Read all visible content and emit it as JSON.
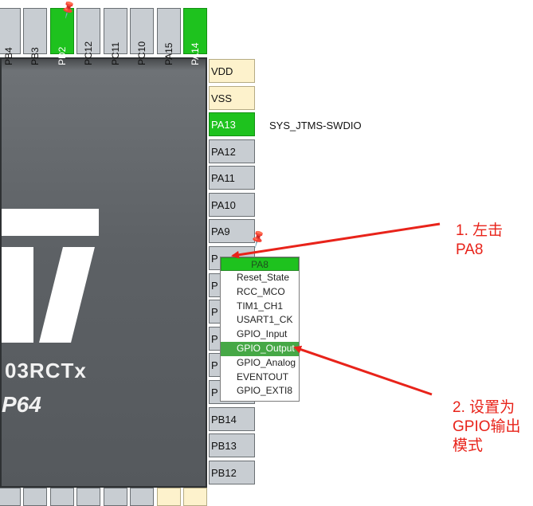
{
  "top_pins": [
    {
      "label": "PB4",
      "state": "default"
    },
    {
      "label": "PB3",
      "state": "default"
    },
    {
      "label": "PD2",
      "state": "assigned"
    },
    {
      "label": "PC12",
      "state": "default"
    },
    {
      "label": "PC11",
      "state": "default"
    },
    {
      "label": "PC10",
      "state": "default"
    },
    {
      "label": "PA15",
      "state": "default"
    },
    {
      "label": "PA14",
      "state": "assigned"
    }
  ],
  "right_pins": [
    {
      "label": "VDD",
      "state": "power"
    },
    {
      "label": "VSS",
      "state": "power"
    },
    {
      "label": "PA13",
      "state": "assigned"
    },
    {
      "label": "PA12",
      "state": "default"
    },
    {
      "label": "PA11",
      "state": "default"
    },
    {
      "label": "PA10",
      "state": "default"
    },
    {
      "label": "PA9",
      "state": "default"
    },
    {
      "label": "P",
      "state": "default"
    },
    {
      "label": "P",
      "state": "default"
    },
    {
      "label": "P",
      "state": "default"
    },
    {
      "label": "P",
      "state": "default"
    },
    {
      "label": "P",
      "state": "default"
    },
    {
      "label": "P",
      "state": "default"
    },
    {
      "label": "PB14",
      "state": "default"
    },
    {
      "label": "PB13",
      "state": "default"
    },
    {
      "label": "PB12",
      "state": "default"
    }
  ],
  "pa13_signal": "SYS_JTMS-SWDIO",
  "chip": {
    "part_text": "03RCTx",
    "package_text": "P64"
  },
  "context_menu": {
    "title": "PA8",
    "items": [
      "Reset_State",
      "RCC_MCO",
      "TIM1_CH1",
      "USART1_CK",
      "GPIO_Input",
      "GPIO_Output",
      "GPIO_Analog",
      "EVENTOUT",
      "GPIO_EXTI8"
    ],
    "selected_index": 5
  },
  "annotations": {
    "step1_line1": "1. 左击",
    "step1_line2": "PA8",
    "step2_line1": "2. 设置为",
    "step2_line2": "GPIO输出",
    "step2_line3": "模式"
  },
  "colors": {
    "assigned": "#1ec21e",
    "power": "#fdf2cc",
    "default_pin": "#c8cdd2",
    "annotation": "#e8231a",
    "chip": "#5d6165"
  },
  "icons": [
    "pushpin-icon"
  ]
}
